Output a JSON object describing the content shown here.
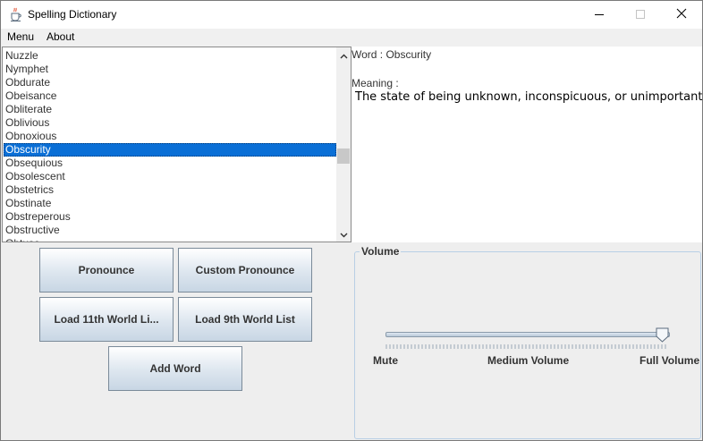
{
  "window": {
    "title": "Spelling Dictionary"
  },
  "icons": {
    "app": "java-coffee-cup-icon",
    "minimize": "minimize-icon",
    "maximize": "maximize-icon",
    "close": "close-icon",
    "scroll_up": "chevron-up-icon",
    "scroll_down": "chevron-down-icon"
  },
  "menubar": {
    "items": [
      "Menu",
      "About"
    ]
  },
  "word_list": {
    "items": [
      "Nuzzle",
      "Nymphet",
      "Obdurate",
      "Obeisance",
      "Obliterate",
      "Oblivious",
      "Obnoxious",
      "Obscurity",
      "Obsequious",
      "Obsolescent",
      "Obstetrics",
      "Obstinate",
      "Obstreperous",
      "Obstructive",
      "Obtuse"
    ],
    "selected_index": 7
  },
  "details": {
    "word_line": "Word : Obscurity",
    "meaning_label": "Meaning :",
    "meaning_text": "The state of being unknown, inconspicuous, or unimportant."
  },
  "buttons": {
    "pronounce": "Pronounce",
    "custom_pronounce": "Custom Pronounce",
    "load_11th": "Load 11th World Li...",
    "load_9th": "Load 9th World List",
    "add_word": "Add Word"
  },
  "volume": {
    "title": "Volume",
    "labels": [
      "Mute",
      "Medium Volume",
      "Full Volume"
    ],
    "level_fraction": 1.0
  },
  "colors": {
    "selection": "#0a6fd6",
    "button_gradient_top": "#ffffff",
    "button_gradient_bottom": "#c8d6e4",
    "border_accent": "#b8cfe5"
  }
}
